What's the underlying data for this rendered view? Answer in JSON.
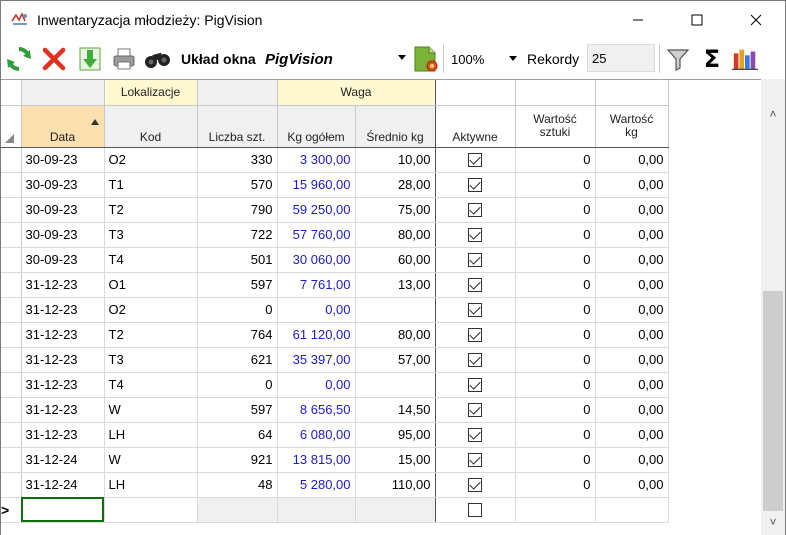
{
  "window": {
    "title": "Inwentaryzacja młodzieży: PigVision",
    "minimize_glyph": "—",
    "maximize_glyph": "☐",
    "close_glyph": "✕"
  },
  "toolbar": {
    "icons": [
      "refresh-icon",
      "delete-icon",
      "export-icon",
      "print-icon",
      "binoculars-icon",
      "layout-settings-icon",
      "filter-icon",
      "sum-icon",
      "chart-icon"
    ],
    "layout_label": "Układ okna",
    "layout_value": "PigVision",
    "zoom_value": "100%",
    "records_label": "Rekordy",
    "records_value": "25",
    "sum_glyph": "Σ"
  },
  "grid": {
    "bands": {
      "lokalizacja": "Lokalizacje",
      "waga": "Waga"
    },
    "columns": {
      "data": "Data",
      "kod": "Kod",
      "liczba": "Liczba szt.",
      "kg_ogolem": "Kg ogółem",
      "srednio": "Średnio kg",
      "aktywne": "Aktywne",
      "wartosc_sztuki_1": "Wartość",
      "wartosc_sztuki_2": "sztuki",
      "wartosc_kg_1": "Wartość",
      "wartosc_kg_2": "kg"
    },
    "rows": [
      {
        "data": "30-09-23",
        "kod": "O2",
        "liczba": "330",
        "kg": "3 300,00",
        "sr": "10,00",
        "aktywne": true,
        "ws": "0",
        "wk": "0,00"
      },
      {
        "data": "30-09-23",
        "kod": "T1",
        "liczba": "570",
        "kg": "15 960,00",
        "sr": "28,00",
        "aktywne": true,
        "ws": "0",
        "wk": "0,00"
      },
      {
        "data": "30-09-23",
        "kod": "T2",
        "liczba": "790",
        "kg": "59 250,00",
        "sr": "75,00",
        "aktywne": true,
        "ws": "0",
        "wk": "0,00"
      },
      {
        "data": "30-09-23",
        "kod": "T3",
        "liczba": "722",
        "kg": "57 760,00",
        "sr": "80,00",
        "aktywne": true,
        "ws": "0",
        "wk": "0,00"
      },
      {
        "data": "30-09-23",
        "kod": "T4",
        "liczba": "501",
        "kg": "30 060,00",
        "sr": "60,00",
        "aktywne": true,
        "ws": "0",
        "wk": "0,00"
      },
      {
        "data": "31-12-23",
        "kod": "O1",
        "liczba": "597",
        "kg": "7 761,00",
        "sr": "13,00",
        "aktywne": true,
        "ws": "0",
        "wk": "0,00"
      },
      {
        "data": "31-12-23",
        "kod": "O2",
        "liczba": "0",
        "kg": "0,00",
        "sr": "",
        "aktywne": true,
        "ws": "0",
        "wk": "0,00"
      },
      {
        "data": "31-12-23",
        "kod": "T2",
        "liczba": "764",
        "kg": "61 120,00",
        "sr": "80,00",
        "aktywne": true,
        "ws": "0",
        "wk": "0,00"
      },
      {
        "data": "31-12-23",
        "kod": "T3",
        "liczba": "621",
        "kg": "35 397,00",
        "sr": "57,00",
        "aktywne": true,
        "ws": "0",
        "wk": "0,00"
      },
      {
        "data": "31-12-23",
        "kod": "T4",
        "liczba": "0",
        "kg": "0,00",
        "sr": "",
        "aktywne": true,
        "ws": "0",
        "wk": "0,00"
      },
      {
        "data": "31-12-23",
        "kod": "W",
        "liczba": "597",
        "kg": "8 656,50",
        "sr": "14,50",
        "aktywne": true,
        "ws": "0",
        "wk": "0,00"
      },
      {
        "data": "31-12-23",
        "kod": "LH",
        "liczba": "64",
        "kg": "6 080,00",
        "sr": "95,00",
        "aktywne": true,
        "ws": "0",
        "wk": "0,00"
      },
      {
        "data": "31-12-24",
        "kod": "W",
        "liczba": "921",
        "kg": "13 815,00",
        "sr": "15,00",
        "aktywne": true,
        "ws": "0",
        "wk": "0,00"
      },
      {
        "data": "31-12-24",
        "kod": "LH",
        "liczba": "48",
        "kg": "5 280,00",
        "sr": "110,00",
        "aktywne": true,
        "ws": "0",
        "wk": "0,00"
      }
    ],
    "new_row_indicator": ">",
    "scroll_up_glyph": "˄",
    "scroll_down_glyph": "˅"
  }
}
